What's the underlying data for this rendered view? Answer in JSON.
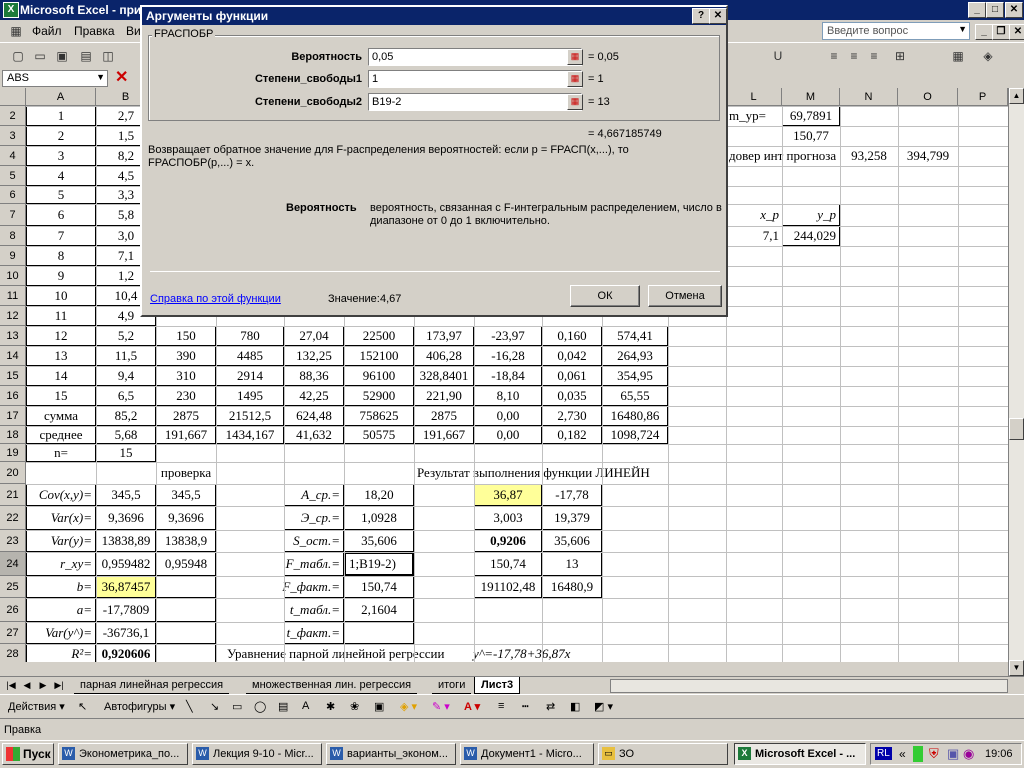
{
  "app": {
    "title": "Microsoft Excel - при"
  },
  "menu": {
    "file": "Файл",
    "edit": "Правка",
    "view": "Ви",
    "help_placeholder": "Введите вопрос"
  },
  "formula_bar": {
    "name_box": "ABS"
  },
  "columns": [
    "A",
    "B",
    "L",
    "M",
    "N",
    "O",
    "P"
  ],
  "rows": [
    "2",
    "3",
    "4",
    "5",
    "6",
    "7",
    "8",
    "9",
    "10",
    "11",
    "12",
    "13",
    "14",
    "15",
    "16",
    "17",
    "18",
    "19",
    "20",
    "21",
    "22",
    "23",
    "24",
    "25",
    "26",
    "27",
    "28"
  ],
  "sheet": {
    "colA": [
      "1",
      "2",
      "3",
      "4",
      "5",
      "6",
      "7",
      "8",
      "9",
      "10",
      "11",
      "12",
      "13",
      "14",
      "15",
      "сумма",
      "среднее",
      "n="
    ],
    "colB": [
      "2,7",
      "1,5",
      "8,2",
      "4,5",
      "3,3",
      "5,8",
      "3,0",
      "7,1",
      "1,2",
      "10,4",
      "4,9",
      "5,2",
      "11,5",
      "9,4",
      "6,5",
      "85,2",
      "5,68",
      "15"
    ],
    "table_rows": [
      [
        "150",
        "780",
        "27,04",
        "22500",
        "173,97",
        "-23,97",
        "0,160",
        "574,41"
      ],
      [
        "390",
        "4485",
        "132,25",
        "152100",
        "406,28",
        "-16,28",
        "0,042",
        "264,93"
      ],
      [
        "310",
        "2914",
        "88,36",
        "96100",
        "328,8401",
        "-18,84",
        "0,061",
        "354,95"
      ],
      [
        "230",
        "1495",
        "42,25",
        "52900",
        "221,90",
        "8,10",
        "0,035",
        "65,55"
      ],
      [
        "2875",
        "21512,5",
        "624,48",
        "758625",
        "2875",
        "0,00",
        "2,730",
        "16480,86"
      ],
      [
        "191,667",
        "1434,167",
        "41,632",
        "50575",
        "191,667",
        "0,00",
        "0,182",
        "1098,724"
      ]
    ],
    "right_top": {
      "m2": "69,7891",
      "m3": "150,77",
      "l2": "m_yp=",
      "l4": "довер инт прогноза",
      "n4": "93,258",
      "o4": "394,799",
      "l7": "x_p",
      "m7": "y_p",
      "l8": "7,1",
      "m8": "244,029"
    },
    "check_label": "проверка",
    "stats_labels": [
      "Cov(x,y)=",
      "Var(x)=",
      "Var(y)=",
      "r_xy=",
      "b=",
      "a=",
      "Var(y^)=",
      "R²="
    ],
    "stats_values": [
      "345,5",
      "9,3696",
      "13838,89",
      "0,959482",
      "36,87457",
      "-17,7809",
      "-36736,1",
      "0,920606"
    ],
    "check_values": [
      "345,5",
      "9,3696",
      "13838,9",
      "0,95948"
    ],
    "mid_labels": [
      "A_ср.=",
      "Э_ср.=",
      "S_ост.=",
      "F_табл.=",
      "F_факт.=",
      "t_табл.=",
      "t_факт.="
    ],
    "mid_values": [
      "18,20",
      "1,0928",
      "35,606",
      "1;B19-2)",
      "150,74",
      "2,1604",
      ""
    ],
    "linest_title": "Результат выполнения функции ЛИНЕЙН",
    "linest": [
      [
        "36,87",
        "-17,78"
      ],
      [
        "3,003",
        "19,379"
      ],
      [
        "0,9206",
        "35,606"
      ],
      [
        "150,74",
        "13"
      ],
      [
        "191102,48",
        "16480,9"
      ]
    ],
    "equation_label": "Уравнение парной линейной регрессии",
    "equation": "y^=-17,78+36,87x"
  },
  "dialog": {
    "title": "Аргументы функции",
    "function_name": "FРАСПОБР",
    "args": [
      {
        "label": "Вероятность",
        "value": "0,05",
        "result": "= 0,05"
      },
      {
        "label": "Степени_свободы1",
        "value": "1",
        "result": "= 1"
      },
      {
        "label": "Степени_свободы2",
        "value": "B19-2",
        "result": "= 13"
      }
    ],
    "formula_result": "= 4,667185749",
    "description": "Возвращает обратное значение для F-распределения вероятностей: если p = FРАСП(x,...), то FРАСПОБР(p,...) = x.",
    "arg_help_label": "Вероятность",
    "arg_help_text": "вероятность, связанная с F-интегральным распределением, число в диапазоне от 0 до 1 включительно.",
    "help_link": "Справка по этой функции",
    "value_label": "Значение:",
    "value": "4,67",
    "ok": "ОК",
    "cancel": "Отмена"
  },
  "tabs": [
    "парная линейная регрессия",
    "множественная лин. регрессия",
    "итоги",
    "Лист3"
  ],
  "drawbar": {
    "actions": "Действия",
    "autoshapes": "Автофигуры"
  },
  "status": "Правка",
  "taskbar": {
    "start": "Пуск",
    "tasks": [
      "Эконометрика_по...",
      "Лекция 9-10 - Micr...",
      "варианты_эконом...",
      "Документ1 - Micro...",
      "ЗО",
      "Microsoft Excel - ..."
    ],
    "lang": "RL",
    "time": "19:06"
  }
}
